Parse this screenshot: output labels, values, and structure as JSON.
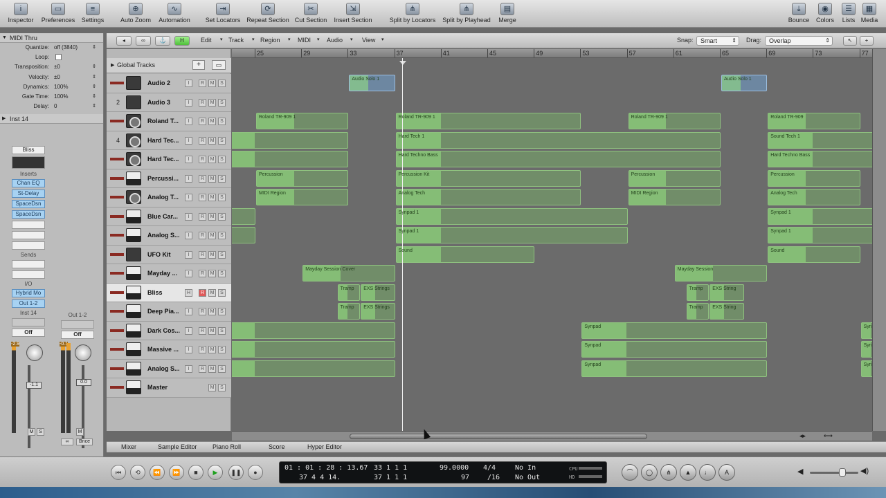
{
  "toolbar": {
    "left_buttons": [
      {
        "icon": "info-icon",
        "glyph": "i",
        "label": "Inspector"
      },
      {
        "icon": "switch-icon",
        "glyph": "▭",
        "label": "Preferences"
      },
      {
        "icon": "sliders-icon",
        "glyph": "≡",
        "label": "Settings"
      },
      {
        "icon": "zoom-icon",
        "glyph": "⊕",
        "label": "Auto Zoom"
      },
      {
        "icon": "automation-icon",
        "glyph": "∿",
        "label": "Automation"
      },
      {
        "icon": "locators-icon",
        "glyph": "⇥",
        "label": "Set Locators"
      },
      {
        "icon": "repeat-icon",
        "glyph": "⟳",
        "label": "Repeat Section"
      },
      {
        "icon": "cut-icon",
        "glyph": "✂",
        "label": "Cut Section"
      },
      {
        "icon": "insert-icon",
        "glyph": "⇲",
        "label": "Insert Section"
      },
      {
        "icon": "split-locators-icon",
        "glyph": "⋔",
        "label": "Split by Locators"
      },
      {
        "icon": "split-playhead-icon",
        "glyph": "⋔",
        "label": "Split by Playhead"
      },
      {
        "icon": "merge-icon",
        "glyph": "▤",
        "label": "Merge"
      }
    ],
    "right_buttons": [
      {
        "icon": "bounce-icon",
        "glyph": "⤓",
        "label": "Bounce"
      },
      {
        "icon": "colors-icon",
        "glyph": "◉",
        "label": "Colors"
      },
      {
        "icon": "lists-icon",
        "glyph": "☰",
        "label": "Lists"
      },
      {
        "icon": "media-icon",
        "glyph": "▦",
        "label": "Media"
      }
    ]
  },
  "inspector": {
    "section1_title": "MIDI Thru",
    "params": [
      {
        "k": "Quantize:",
        "v": "off (3840)"
      },
      {
        "k": "Loop:",
        "v": ""
      },
      {
        "k": "Transposition:",
        "v": "±0"
      },
      {
        "k": "Velocity:",
        "v": "±0"
      },
      {
        "k": "Dynamics:",
        "v": "100%"
      },
      {
        "k": "Gate Time:",
        "v": "100%"
      },
      {
        "k": "Delay:",
        "v": "0"
      }
    ],
    "section2_title": "Inst 14",
    "strip_left": {
      "instrument": "Bliss",
      "inserts_label": "Inserts",
      "inserts": [
        "Chan EQ",
        "St-Delay",
        "SpaceDsn",
        "SpaceDsn"
      ],
      "sends_label": "Sends",
      "io_label": "I/O",
      "input": "Hybrid Mo",
      "output": "Out 1-2",
      "name": "Inst 14",
      "automation": "Off",
      "meter_value": "-2.9",
      "fader_value": "-1.1",
      "mute": "M",
      "solo": "S"
    },
    "strip_right": {
      "name": "Out 1-2",
      "automation": "Off",
      "meter_value": "-0.1",
      "fader_value": "0.0",
      "mute": "M",
      "bnce": "Bnce",
      "link": "∞"
    }
  },
  "menubar": {
    "menus": [
      "Edit",
      "Track",
      "Region",
      "MIDI",
      "Audio",
      "View"
    ],
    "snap_label": "Snap:",
    "snap_value": "Smart",
    "drag_label": "Drag:",
    "drag_value": "Overlap",
    "h_button": "H"
  },
  "global_tracks": {
    "label": "Global Tracks",
    "add": "+"
  },
  "tracks": [
    {
      "num": "",
      "name": "Audio 2",
      "icon": "waveform-icon",
      "type": "audio"
    },
    {
      "num": "2",
      "name": "Audio 3",
      "icon": "waveform-icon",
      "type": "audio"
    },
    {
      "num": "",
      "name": "Roland T...",
      "icon": "synth-icon",
      "type": "round"
    },
    {
      "num": "4",
      "name": "Hard Tec...",
      "icon": "synth-icon",
      "type": "round"
    },
    {
      "num": "",
      "name": "Hard Tec...",
      "icon": "synth-icon",
      "type": "round"
    },
    {
      "num": "",
      "name": "Percussi...",
      "icon": "drum-icon",
      "type": "keys"
    },
    {
      "num": "",
      "name": "Analog T...",
      "icon": "synth-icon",
      "type": "round"
    },
    {
      "num": "",
      "name": "Blue Car...",
      "icon": "keyboard-icon",
      "type": "keys"
    },
    {
      "num": "",
      "name": "Analog S...",
      "icon": "keyboard-icon",
      "type": "keys"
    },
    {
      "num": "",
      "name": "UFO Kit",
      "icon": "drumkit-icon",
      "type": "plain"
    },
    {
      "num": "",
      "name": "Mayday ...",
      "icon": "keyboard-icon",
      "type": "keys"
    },
    {
      "num": "",
      "name": "Bliss",
      "icon": "keyboard-icon",
      "type": "keys"
    },
    {
      "num": "",
      "name": "Deep Pia...",
      "icon": "keyboard-icon",
      "type": "keys"
    },
    {
      "num": "",
      "name": "Dark Cos...",
      "icon": "keyboard-icon",
      "type": "keys"
    },
    {
      "num": "",
      "name": "Massive ...",
      "icon": "keyboard-icon",
      "type": "keys"
    },
    {
      "num": "",
      "name": "Analog S...",
      "icon": "keyboard-icon",
      "type": "keys"
    },
    {
      "num": "",
      "name": "Master",
      "icon": "master-icon",
      "type": "keys"
    }
  ],
  "ruler": {
    "bars": [
      "25",
      "29",
      "33",
      "37",
      "41",
      "45",
      "49",
      "53",
      "57",
      "61",
      "65",
      "69",
      "73",
      "77"
    ]
  },
  "regions": [
    {
      "track": 0,
      "start": 33,
      "len": 4,
      "label": "Audio Solo 1",
      "audio": true
    },
    {
      "track": 0,
      "start": 65,
      "len": 4,
      "label": "Audio Solo 1",
      "audio": true
    },
    {
      "track": 2,
      "start": 25,
      "len": 8,
      "label": "Roland TR-909 1"
    },
    {
      "track": 2,
      "start": 37,
      "len": 16,
      "label": "Roland TR-909 1"
    },
    {
      "track": 2,
      "start": 57,
      "len": 8,
      "label": "Roland TR-909 1"
    },
    {
      "track": 2,
      "start": 69,
      "len": 8,
      "label": "Roland TR-909"
    },
    {
      "track": 3,
      "start": 21,
      "len": 12,
      "label": ""
    },
    {
      "track": 3,
      "start": 37,
      "len": 28,
      "label": "Hard Tech 1"
    },
    {
      "track": 3,
      "start": 69,
      "len": 12,
      "label": "Sound Tech 1"
    },
    {
      "track": 4,
      "start": 21,
      "len": 12,
      "label": ""
    },
    {
      "track": 4,
      "start": 37,
      "len": 28,
      "label": "Hard Techno Bass"
    },
    {
      "track": 4,
      "start": 69,
      "len": 12,
      "label": "Hard Techno Bass"
    },
    {
      "track": 5,
      "start": 25,
      "len": 8,
      "label": "Percussion"
    },
    {
      "track": 5,
      "start": 37,
      "len": 16,
      "label": "Percussion Kit"
    },
    {
      "track": 5,
      "start": 57,
      "len": 8,
      "label": "Percussion"
    },
    {
      "track": 5,
      "start": 69,
      "len": 8,
      "label": "Percussion"
    },
    {
      "track": 6,
      "start": 25,
      "len": 8,
      "label": "MIDI Region"
    },
    {
      "track": 6,
      "start": 37,
      "len": 16,
      "label": "Analog Tech"
    },
    {
      "track": 6,
      "start": 57,
      "len": 8,
      "label": "MIDI Region"
    },
    {
      "track": 6,
      "start": 69,
      "len": 8,
      "label": "Analog Tech"
    },
    {
      "track": 7,
      "start": 21,
      "len": 4,
      "label": ""
    },
    {
      "track": 7,
      "start": 37,
      "len": 20,
      "label": "Synpad 1"
    },
    {
      "track": 7,
      "start": 69,
      "len": 12,
      "label": "Synpad 1"
    },
    {
      "track": 8,
      "start": 21,
      "len": 4,
      "label": ""
    },
    {
      "track": 8,
      "start": 37,
      "len": 20,
      "label": "Synpad 1"
    },
    {
      "track": 8,
      "start": 69,
      "len": 12,
      "label": "Synpad 1"
    },
    {
      "track": 9,
      "start": 37,
      "len": 12,
      "label": "Sound"
    },
    {
      "track": 9,
      "start": 69,
      "len": 8,
      "label": "Sound"
    },
    {
      "track": 10,
      "start": 29,
      "len": 8,
      "label": "Mayday Session Cover"
    },
    {
      "track": 10,
      "start": 61,
      "len": 8,
      "label": "Mayday Session"
    },
    {
      "track": 11,
      "start": 32,
      "len": 2,
      "label": "Tramp"
    },
    {
      "track": 11,
      "start": 34,
      "len": 3,
      "label": "EXS Strings"
    },
    {
      "track": 11,
      "start": 62,
      "len": 2,
      "label": "Tramp"
    },
    {
      "track": 11,
      "start": 64,
      "len": 3,
      "label": "EXS String"
    },
    {
      "track": 12,
      "start": 32,
      "len": 2,
      "label": "Tramp"
    },
    {
      "track": 12,
      "start": 34,
      "len": 3,
      "label": "EXS Strings"
    },
    {
      "track": 12,
      "start": 62,
      "len": 2,
      "label": "Tramp"
    },
    {
      "track": 12,
      "start": 64,
      "len": 3,
      "label": "EXS String"
    },
    {
      "track": 13,
      "start": 21,
      "len": 16,
      "label": ""
    },
    {
      "track": 13,
      "start": 53,
      "len": 16,
      "label": "Synpad"
    },
    {
      "track": 13,
      "start": 77,
      "len": 2,
      "label": "Syn"
    },
    {
      "track": 14,
      "start": 21,
      "len": 16,
      "label": ""
    },
    {
      "track": 14,
      "start": 53,
      "len": 16,
      "label": "Synpad"
    },
    {
      "track": 14,
      "start": 77,
      "len": 2,
      "label": "Syn"
    },
    {
      "track": 15,
      "start": 21,
      "len": 16,
      "label": ""
    },
    {
      "track": 15,
      "start": 53,
      "len": 16,
      "label": "Synpad"
    },
    {
      "track": 15,
      "start": 77,
      "len": 2,
      "label": "Syn"
    }
  ],
  "playhead_bar": 37,
  "bottom_tabs": [
    "Mixer",
    "Sample Editor",
    "Piano Roll",
    "Score",
    "Hyper Editor"
  ],
  "transport": {
    "smpte": "01 : 01 : 28 : 13.67",
    "bars_pos": "37   4   4   14.",
    "left_loc": "33   1   1   1",
    "right_loc": "37   1   1   1",
    "tempo": "99.0000",
    "tempo2": "97",
    "sig_top": "4/4",
    "sig_bottom": "/16",
    "in": "No In",
    "out": "No Out",
    "cpu": "CPU",
    "hd": "HD"
  }
}
